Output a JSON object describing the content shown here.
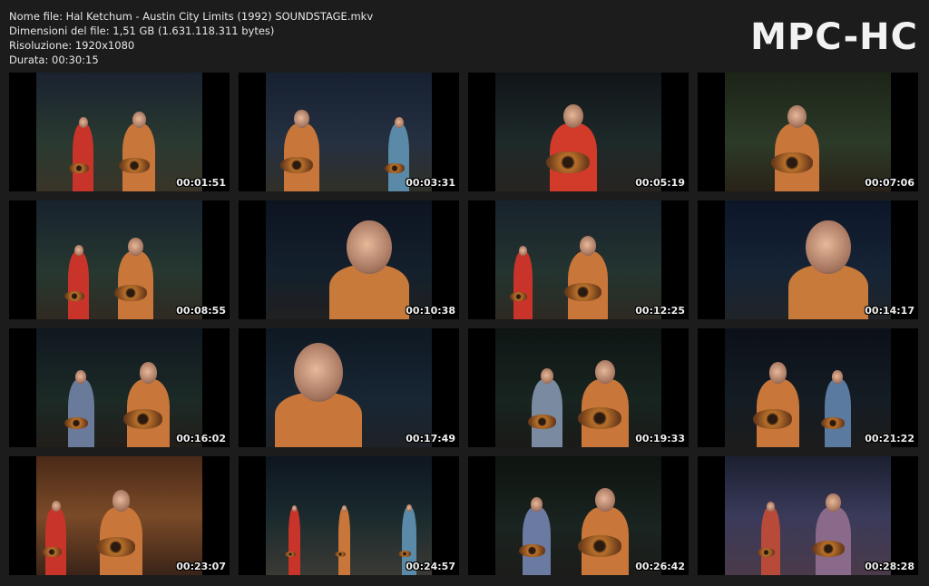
{
  "file_info": {
    "name_line": "Nome file: Hal Ketchum - Austin City Limits (1992) SOUNDSTAGE.mkv",
    "size_line": "Dimensioni del file: 1,51 GB (1.631.118.311 bytes)",
    "resolution_line": "Risoluzione: 1920x1080",
    "duration_line": "Durata: 00:30:15"
  },
  "logo": "MPC-HC",
  "thumbnails": [
    {
      "timestamp": "00:01:51"
    },
    {
      "timestamp": "00:03:31"
    },
    {
      "timestamp": "00:05:19"
    },
    {
      "timestamp": "00:07:06"
    },
    {
      "timestamp": "00:08:55"
    },
    {
      "timestamp": "00:10:38"
    },
    {
      "timestamp": "00:12:25"
    },
    {
      "timestamp": "00:14:17"
    },
    {
      "timestamp": "00:16:02"
    },
    {
      "timestamp": "00:17:49"
    },
    {
      "timestamp": "00:19:33"
    },
    {
      "timestamp": "00:21:22"
    },
    {
      "timestamp": "00:23:07"
    },
    {
      "timestamp": "00:24:57"
    },
    {
      "timestamp": "00:26:42"
    },
    {
      "timestamp": "00:28:28"
    }
  ],
  "colors": {
    "background": "#1c1c1c",
    "text": "#e6e6e6",
    "shirt_orange": "#d9833a",
    "shirt_red": "#c8342a"
  }
}
